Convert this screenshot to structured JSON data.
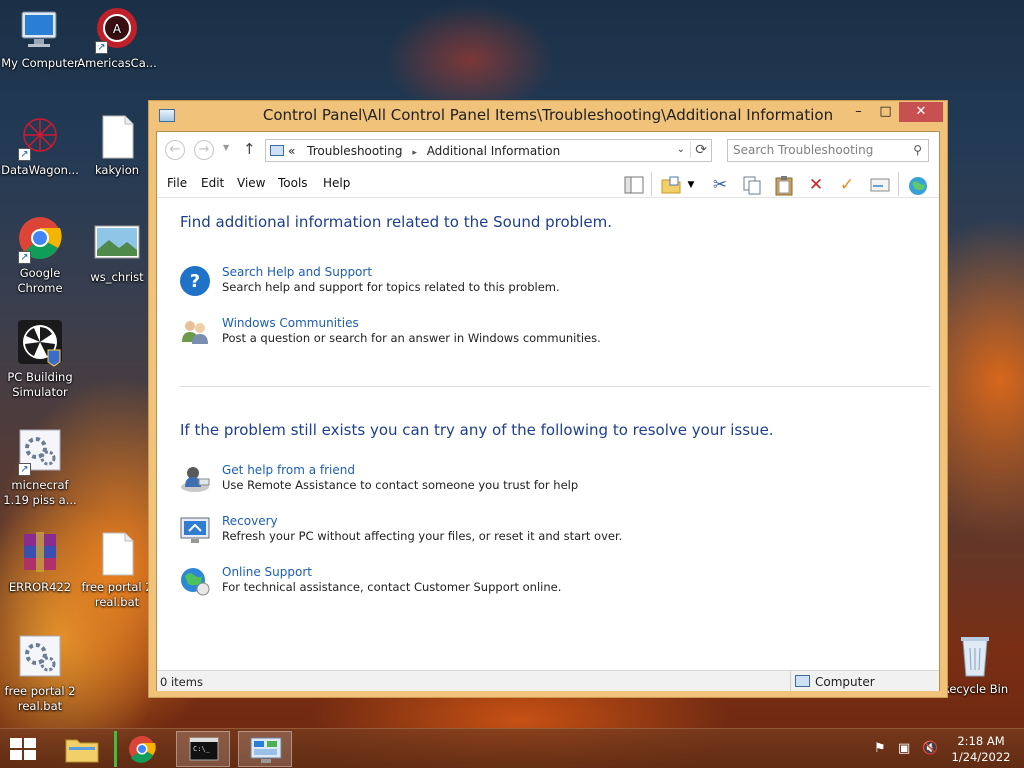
{
  "desktop": {
    "icons": [
      {
        "id": "my-computer",
        "label": "My Computer"
      },
      {
        "id": "americas-cardroom",
        "label": "AmericasCa..."
      },
      {
        "id": "datawagon",
        "label": "DataWagon..."
      },
      {
        "id": "kakyion",
        "label": "kakyion"
      },
      {
        "id": "google-chrome",
        "label": "Google Chrome"
      },
      {
        "id": "ws-christ",
        "label": "ws_christ"
      },
      {
        "id": "pc-building-simulator",
        "label": "PC Building Simulator"
      },
      {
        "id": "micnecraf",
        "label": "micnecraf 1.19 piss a..."
      },
      {
        "id": "error422",
        "label": "ERROR422"
      },
      {
        "id": "free-portal-2-a",
        "label": "free portal 2 real.bat"
      },
      {
        "id": "free-portal-2-b",
        "label": "free portal 2 real.bat"
      },
      {
        "id": "recycle-bin",
        "label": "Recycle Bin"
      }
    ]
  },
  "window": {
    "title": "Control Panel\\All Control Panel Items\\Troubleshooting\\Additional Information",
    "buttons": {
      "minimize": "–",
      "maximize": "□",
      "close": "✕"
    },
    "address": {
      "prefix": "«",
      "crumbs": [
        "Troubleshooting",
        "Additional Information"
      ],
      "separator": "▸"
    },
    "search": {
      "placeholder": "Search Troubleshooting"
    },
    "menu": [
      "File",
      "Edit",
      "View",
      "Tools",
      "Help"
    ],
    "toolbar_icons": [
      "layout-pane-icon",
      "folder-options-icon",
      "cut-icon",
      "copy-icon",
      "paste-icon",
      "delete-icon",
      "properties-check-icon",
      "mail-icon",
      "web-globe-icon"
    ],
    "section1": {
      "heading": "Find additional information related to the Sound problem.",
      "tasks": [
        {
          "icon": "help-question-icon",
          "link": "Search Help and Support",
          "desc": "Search help and support for topics related to this problem."
        },
        {
          "icon": "community-people-icon",
          "link": "Windows Communities",
          "desc": "Post a question or search for an answer in Windows communities."
        }
      ]
    },
    "section2": {
      "heading": "If the problem still exists you can try any of the following to resolve your issue.",
      "tasks": [
        {
          "icon": "remote-assistance-icon",
          "link": "Get help from a friend",
          "desc": "Use Remote Assistance to contact someone you trust for help"
        },
        {
          "icon": "recovery-monitor-icon",
          "link": "Recovery",
          "desc": "Refresh your PC without affecting your files, or reset it and start over."
        },
        {
          "icon": "online-support-globe-icon",
          "link": "Online Support",
          "desc": "For technical assistance, contact Customer Support online."
        }
      ]
    },
    "status": {
      "items": "0 items",
      "zone": "Computer"
    }
  },
  "taskbar": {
    "apps": [
      "file-explorer",
      "google-chrome",
      "command-prompt",
      "control-panel"
    ],
    "time": "2:18 AM",
    "date": "1/24/2022"
  },
  "colors": {
    "link": "#1e5fb0",
    "heading": "#1e3f8f",
    "title_bar": "#f0c27a",
    "close": "#c75050"
  }
}
